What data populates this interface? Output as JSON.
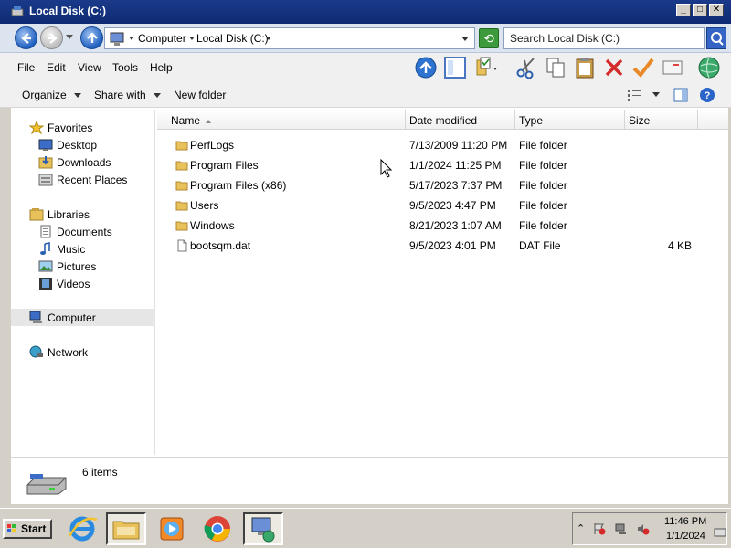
{
  "window": {
    "title": "Local Disk (C:)"
  },
  "address": {
    "crumbs": [
      "Computer",
      "Local Disk (C:)"
    ],
    "search_placeholder": "Search Local Disk (C:)"
  },
  "menu": [
    "File",
    "Edit",
    "View",
    "Tools",
    "Help"
  ],
  "commands": {
    "organize": "Organize",
    "share_with": "Share with",
    "new_folder": "New folder"
  },
  "nav": {
    "favorites": {
      "label": "Favorites",
      "items": [
        "Desktop",
        "Downloads",
        "Recent Places"
      ]
    },
    "libraries": {
      "label": "Libraries",
      "items": [
        "Documents",
        "Music",
        "Pictures",
        "Videos"
      ]
    },
    "computer": "Computer",
    "network": "Network"
  },
  "columns": {
    "name": "Name",
    "date": "Date modified",
    "type": "Type",
    "size": "Size"
  },
  "files": [
    {
      "name": "PerfLogs",
      "date": "7/13/2009 11:20 PM",
      "type": "File folder",
      "size": "",
      "icon": "folder-icon"
    },
    {
      "name": "Program Files",
      "date": "1/1/2024 11:25 PM",
      "type": "File folder",
      "size": "",
      "icon": "folder-icon"
    },
    {
      "name": "Program Files (x86)",
      "date": "5/17/2023 7:37 PM",
      "type": "File folder",
      "size": "",
      "icon": "folder-icon"
    },
    {
      "name": "Users",
      "date": "9/5/2023 4:47 PM",
      "type": "File folder",
      "size": "",
      "icon": "folder-icon"
    },
    {
      "name": "Windows",
      "date": "8/21/2023 1:07 AM",
      "type": "File folder",
      "size": "",
      "icon": "folder-icon"
    },
    {
      "name": "bootsqm.dat",
      "date": "9/5/2023 4:01 PM",
      "type": "DAT File",
      "size": "4 KB",
      "icon": "file-icon"
    }
  ],
  "details": {
    "count": "6 items"
  },
  "taskbar": {
    "start": "Start",
    "apps": [
      "internet-explorer-icon",
      "file-explorer-icon",
      "media-player-icon",
      "chrome-icon",
      "network-app-icon"
    ],
    "time": "11:46 PM",
    "date": "1/1/2024"
  },
  "colors": {
    "title_bar": "#1a3a8a",
    "folder": "#e8c15a",
    "selection": "#e6e6e6"
  }
}
